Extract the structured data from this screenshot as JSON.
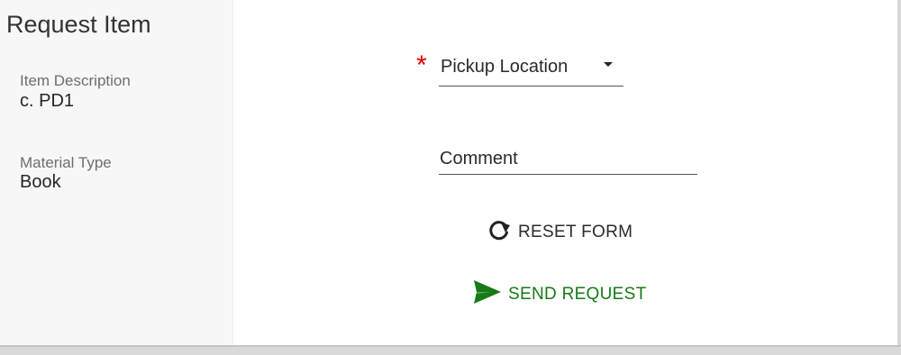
{
  "panel": {
    "title": "Request Item",
    "fields": [
      {
        "label": "Item Description",
        "value": "c. PD1"
      },
      {
        "label": "Material Type",
        "value": "Book"
      }
    ]
  },
  "form": {
    "required_marker": "*",
    "pickup_location": {
      "label": "Pickup Location",
      "icon": "caret-down-icon"
    },
    "comment": {
      "label": "Comment"
    },
    "reset_button": {
      "label": "RESET FORM",
      "icon": "refresh-icon"
    },
    "send_button": {
      "label": "SEND REQUEST",
      "icon": "send-icon"
    }
  },
  "colors": {
    "accent_green": "#177a17",
    "required_red": "#e00000",
    "panel_bg": "#f7f7f7"
  }
}
